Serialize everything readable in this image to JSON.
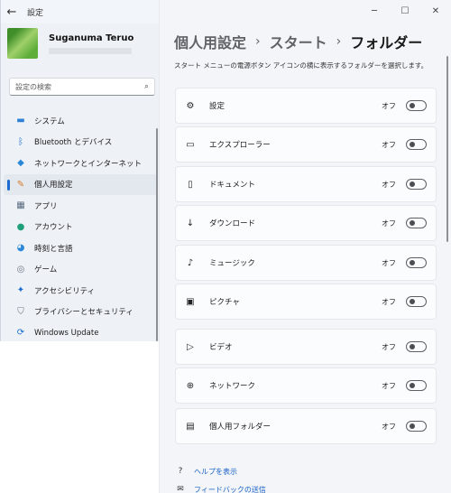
{
  "window": {
    "title": "設定",
    "back_glyph": "←",
    "minimize_glyph": "─",
    "maximize_glyph": "☐",
    "close_glyph": "✕"
  },
  "user": {
    "name": "Suganuma Teruo"
  },
  "search": {
    "placeholder": "設定の検索",
    "icon": "search-icon"
  },
  "sidebar": {
    "items": [
      {
        "label": "システム",
        "icon": "system-icon",
        "glyph": "▬",
        "color": "#2e7fd6",
        "selected": false
      },
      {
        "label": "Bluetooth とデバイス",
        "icon": "bluetooth-icon",
        "glyph": "ᛒ",
        "color": "#1d6dd0",
        "selected": false
      },
      {
        "label": "ネットワークとインターネット",
        "icon": "wifi-icon",
        "glyph": "◆",
        "color": "#2b88d8",
        "selected": false
      },
      {
        "label": "個人用設定",
        "icon": "brush-icon",
        "glyph": "✎",
        "color": "#d97a2b",
        "selected": true
      },
      {
        "label": "アプリ",
        "icon": "apps-icon",
        "glyph": "▦",
        "color": "#5b6b80",
        "selected": false
      },
      {
        "label": "アカウント",
        "icon": "account-icon",
        "glyph": "●",
        "color": "#1fa07a",
        "selected": false
      },
      {
        "label": "時刻と言語",
        "icon": "globe-clock-icon",
        "glyph": "◕",
        "color": "#2b88d8",
        "selected": false
      },
      {
        "label": "ゲーム",
        "icon": "gamepad-icon",
        "glyph": "◎",
        "color": "#6b7480",
        "selected": false
      },
      {
        "label": "アクセシビリティ",
        "icon": "accessibility-icon",
        "glyph": "✦",
        "color": "#1d6dd0",
        "selected": false
      },
      {
        "label": "プライバシーとセキュリティ",
        "icon": "shield-icon",
        "glyph": "⛉",
        "color": "#6b7480",
        "selected": false
      },
      {
        "label": "Windows Update",
        "icon": "update-icon",
        "glyph": "⟳",
        "color": "#1d6dd0",
        "selected": false
      }
    ]
  },
  "breadcrumb": {
    "parts": [
      "個人用設定",
      "スタート",
      "フォルダー"
    ],
    "separator": "›"
  },
  "description": "スタート メニューの電源ボタン アイコンの横に表示するフォルダーを選択します。",
  "folders": [
    {
      "label": "設定",
      "icon": "gear-icon",
      "glyph": "⚙",
      "state": "オフ"
    },
    {
      "label": "エクスプローラー",
      "icon": "folder-icon",
      "glyph": "▭",
      "state": "オフ"
    },
    {
      "label": "ドキュメント",
      "icon": "document-icon",
      "glyph": "▯",
      "state": "オフ"
    },
    {
      "label": "ダウンロード",
      "icon": "download-icon",
      "glyph": "↓",
      "state": "オフ"
    },
    {
      "label": "ミュージック",
      "icon": "music-icon",
      "glyph": "♪",
      "state": "オフ"
    },
    {
      "label": "ピクチャ",
      "icon": "picture-icon",
      "glyph": "▣",
      "state": "オフ"
    },
    {
      "label": "ビデオ",
      "icon": "video-icon",
      "glyph": "▷",
      "state": "オフ"
    },
    {
      "label": "ネットワーク",
      "icon": "network-icon",
      "glyph": "⊕",
      "state": "オフ"
    },
    {
      "label": "個人用フォルダー",
      "icon": "user-folder-icon",
      "glyph": "▤",
      "state": "オフ"
    }
  ],
  "links": [
    {
      "label": "ヘルプを表示",
      "icon": "help-icon",
      "glyph": "?"
    },
    {
      "label": "フィードバックの送信",
      "icon": "feedback-icon",
      "glyph": "✉"
    }
  ]
}
